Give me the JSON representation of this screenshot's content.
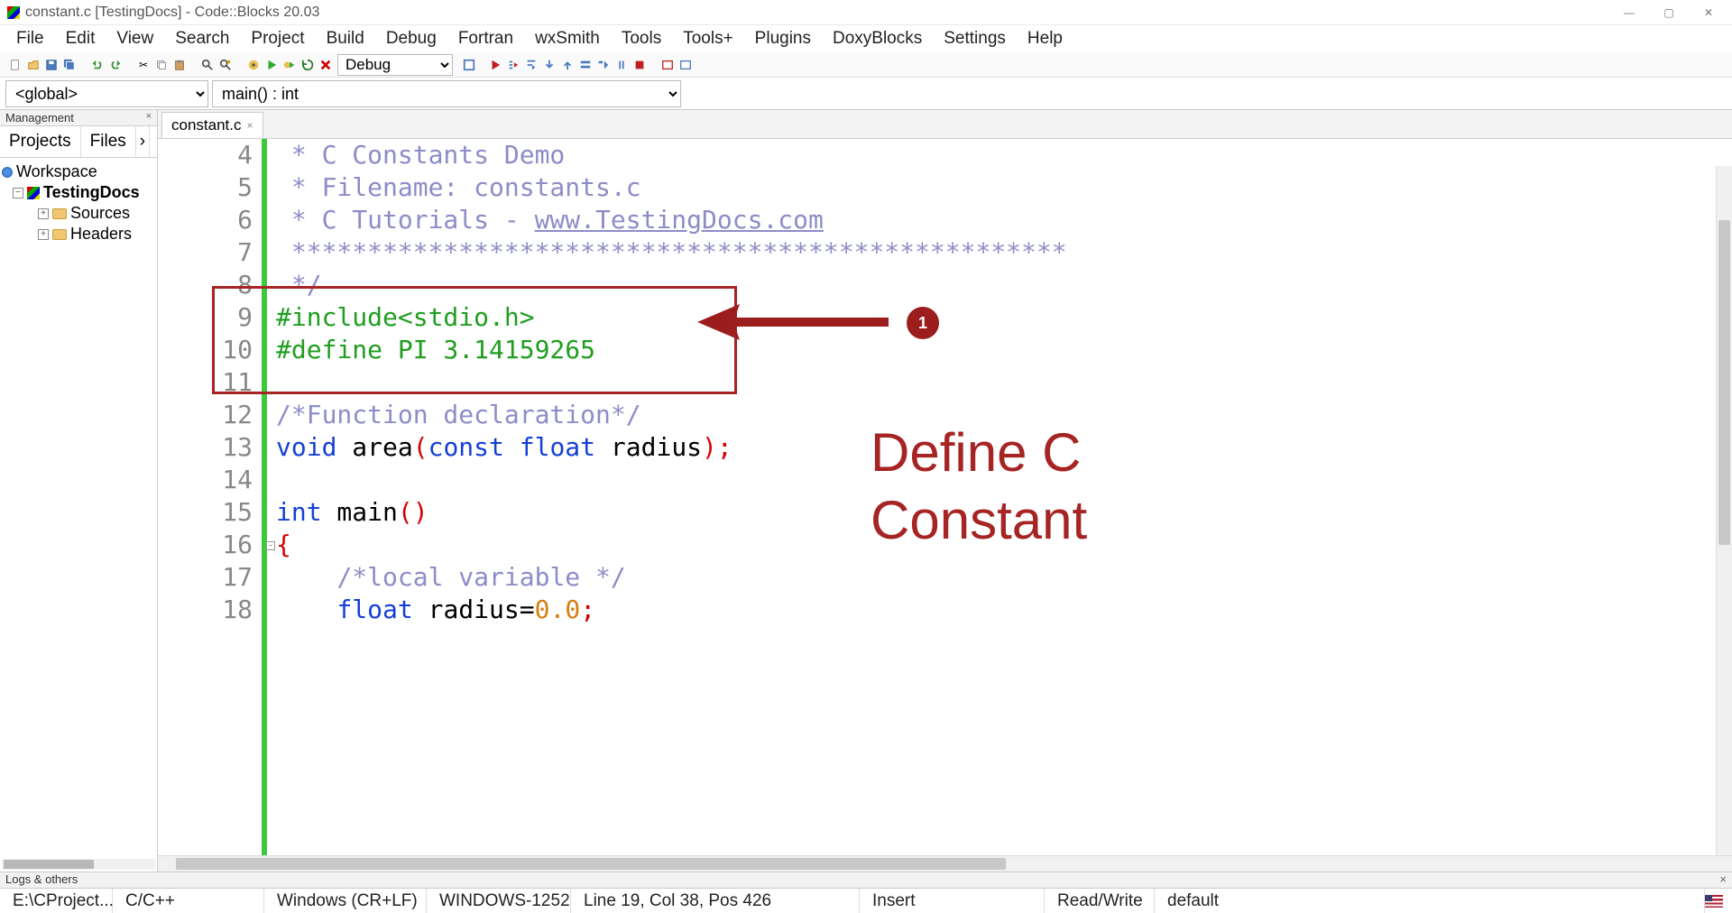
{
  "window": {
    "title": "constant.c [TestingDocs] - Code::Blocks 20.03",
    "controls": {
      "min": "—",
      "max": "▢",
      "close": "✕"
    }
  },
  "menu": [
    "File",
    "Edit",
    "View",
    "Search",
    "Project",
    "Build",
    "Debug",
    "Fortran",
    "wxSmith",
    "Tools",
    "Tools+",
    "Plugins",
    "DoxyBlocks",
    "Settings",
    "Help"
  ],
  "toolbar": {
    "config": "Debug"
  },
  "scope": {
    "global": "<global>",
    "fn": "main() : int"
  },
  "sidebar": {
    "title": "Management",
    "tabs": [
      "Projects",
      "Files"
    ],
    "more": "›",
    "workspace": "Workspace",
    "project": "TestingDocs",
    "folders": [
      "Sources",
      "Headers"
    ]
  },
  "editor": {
    "tab": "constant.c",
    "startLine": 4,
    "lines": [
      [
        {
          "t": " * C Constants Demo",
          "c": "c-comment"
        }
      ],
      [
        {
          "t": " * Filename: constants.c",
          "c": "c-comment"
        }
      ],
      [
        {
          "t": " * C Tutorials - ",
          "c": "c-comment"
        },
        {
          "t": "www.TestingDocs.com",
          "c": "c-link"
        }
      ],
      [
        {
          "t": " ***************************************************",
          "c": "c-comment"
        }
      ],
      [
        {
          "t": " */",
          "c": "c-comment"
        }
      ],
      [
        {
          "t": "#include<stdio.h>",
          "c": "c-preproc"
        }
      ],
      [
        {
          "t": "#define PI 3.14159265",
          "c": "c-preproc"
        }
      ],
      [
        {
          "t": "",
          "c": ""
        }
      ],
      [
        {
          "t": "/*Function declaration*/",
          "c": "c-comment"
        }
      ],
      [
        {
          "t": "void",
          "c": "c-keyword"
        },
        {
          "t": " area",
          "c": "c-ident"
        },
        {
          "t": "(",
          "c": "c-paren"
        },
        {
          "t": "const float",
          "c": "c-keyword"
        },
        {
          "t": " radius",
          "c": "c-ident"
        },
        {
          "t": ")",
          "c": "c-paren"
        },
        {
          "t": ";",
          "c": "c-semi"
        }
      ],
      [
        {
          "t": "",
          "c": ""
        }
      ],
      [
        {
          "t": "int",
          "c": "c-keyword"
        },
        {
          "t": " main",
          "c": "c-ident"
        },
        {
          "t": "()",
          "c": "c-paren"
        }
      ],
      [
        {
          "t": "{",
          "c": "c-paren"
        }
      ],
      [
        {
          "t": "    ",
          "c": ""
        },
        {
          "t": "/*local variable */",
          "c": "c-comment"
        }
      ],
      [
        {
          "t": "    ",
          "c": ""
        },
        {
          "t": "float",
          "c": "c-keyword"
        },
        {
          "t": " radius",
          "c": "c-ident"
        },
        {
          "t": "=",
          "c": "c-ident"
        },
        {
          "t": "0.0",
          "c": "c-number"
        },
        {
          "t": ";",
          "c": "c-semi"
        }
      ]
    ]
  },
  "annotation": {
    "badge": "1",
    "text1": "Define C",
    "text2": "Constant"
  },
  "logs": {
    "title": "Logs & others"
  },
  "status": {
    "path": "E:\\CProject...",
    "lang": "C/C++",
    "eol": "Windows (CR+LF)",
    "enc": "WINDOWS-1252",
    "pos": "Line 19, Col 38, Pos 426",
    "mode": "Insert",
    "rw": "Read/Write",
    "profile": "default"
  }
}
